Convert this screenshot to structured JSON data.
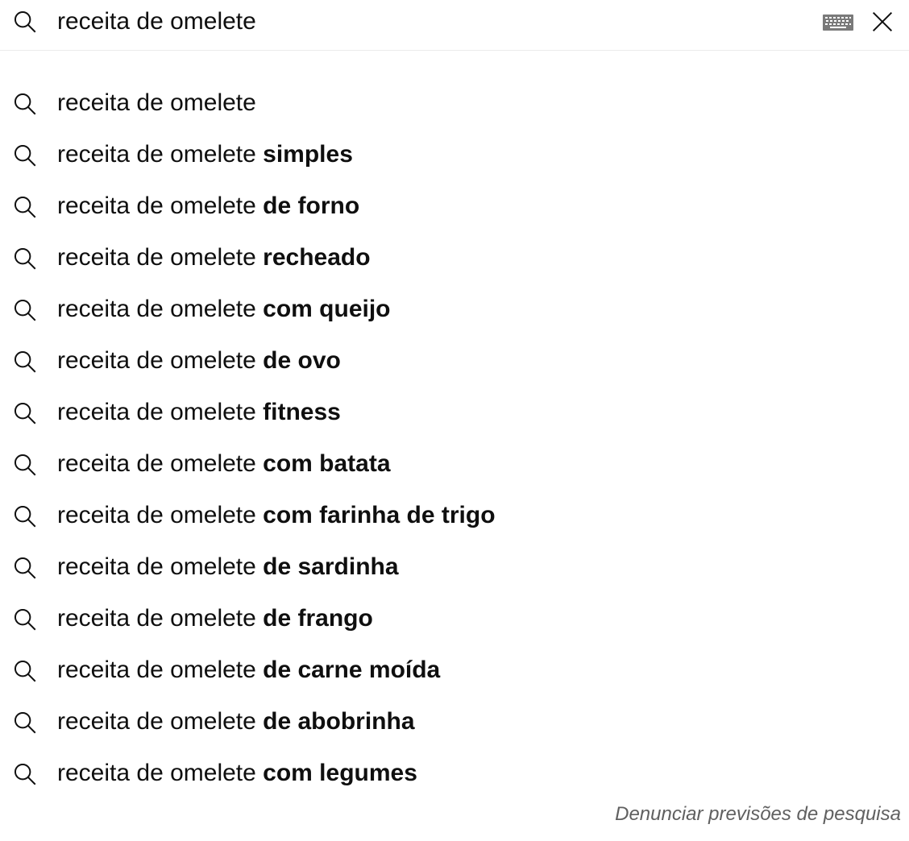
{
  "search": {
    "query": "receita de omelete",
    "icon": "search-icon",
    "keyboard_icon": "keyboard-icon",
    "clear_icon": "close-icon"
  },
  "suggestions": [
    {
      "prefix": "receita de omelete",
      "completion": ""
    },
    {
      "prefix": "receita de omelete ",
      "completion": "simples"
    },
    {
      "prefix": "receita de omelete ",
      "completion": "de forno"
    },
    {
      "prefix": "receita de omelete ",
      "completion": "recheado"
    },
    {
      "prefix": "receita de omelete ",
      "completion": "com queijo"
    },
    {
      "prefix": "receita de omelete ",
      "completion": "de ovo"
    },
    {
      "prefix": "receita de omelete ",
      "completion": "fitness"
    },
    {
      "prefix": "receita de omelete ",
      "completion": "com batata"
    },
    {
      "prefix": "receita de omelete ",
      "completion": "com farinha de trigo"
    },
    {
      "prefix": "receita de omelete ",
      "completion": "de sardinha"
    },
    {
      "prefix": "receita de omelete ",
      "completion": "de frango"
    },
    {
      "prefix": "receita de omelete ",
      "completion": "de carne moída"
    },
    {
      "prefix": "receita de omelete ",
      "completion": "de abobrinha"
    },
    {
      "prefix": "receita de omelete ",
      "completion": "com legumes"
    }
  ],
  "footer": {
    "report_label": "Denunciar previsões de pesquisa"
  }
}
